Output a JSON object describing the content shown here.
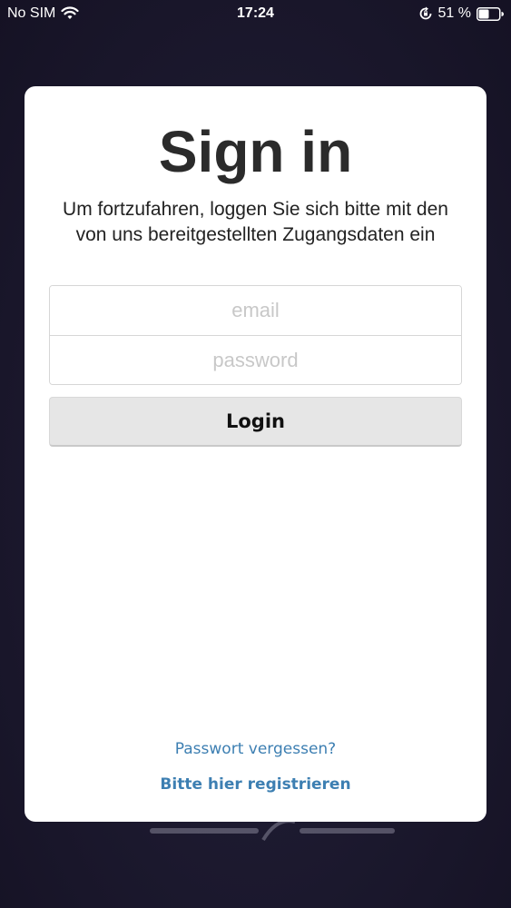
{
  "status_bar": {
    "carrier": "No SIM",
    "time": "17:24",
    "battery_percent": "51 %",
    "icons": [
      "wifi-icon",
      "rotation-lock-icon",
      "battery-icon"
    ]
  },
  "login": {
    "title": "Sign in",
    "subtitle": "Um fortzufahren, loggen Sie sich bitte mit den von uns bereitgestellten Zugangsdaten ein",
    "email_placeholder": "email",
    "password_placeholder": "password",
    "email_value": "",
    "password_value": "",
    "login_label": "Login",
    "forgot_password": "Passwort vergessen?",
    "register": "Bitte hier registrieren"
  },
  "colors": {
    "background": "#1d1a30",
    "card": "#ffffff",
    "button": "#e6e6e6",
    "link": "#3d7fb2"
  }
}
